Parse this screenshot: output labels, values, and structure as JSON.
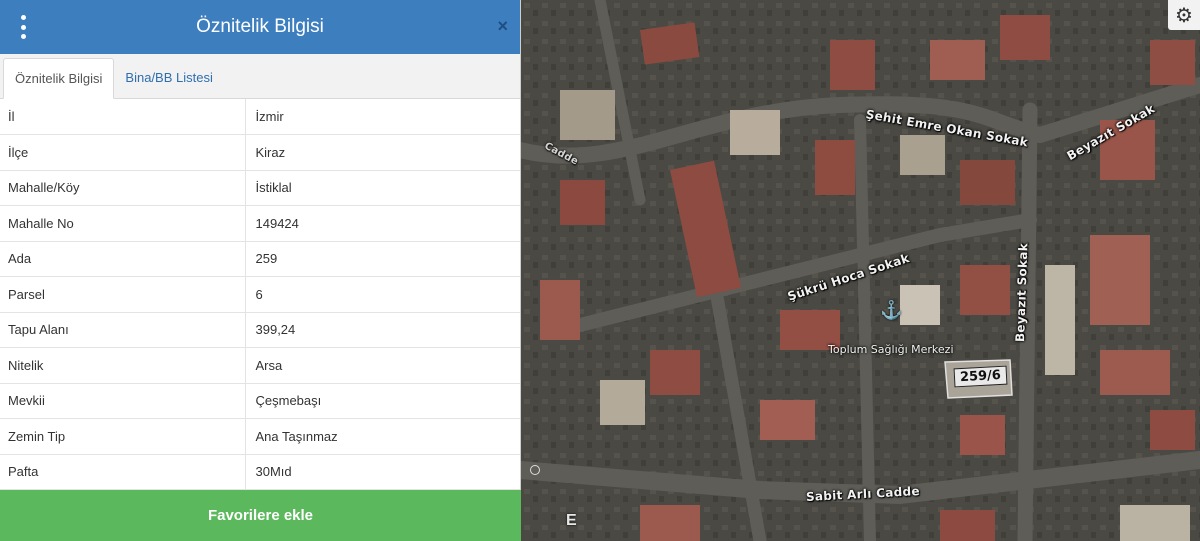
{
  "panel": {
    "title": "Öznitelik Bilgisi",
    "close_symbol": "×",
    "tabs": [
      {
        "label": "Öznitelik Bilgisi",
        "active": true
      },
      {
        "label": "Bina/BB Listesi",
        "active": false
      }
    ],
    "rows": [
      {
        "key": "İl",
        "value": "İzmir"
      },
      {
        "key": "İlçe",
        "value": "Kiraz"
      },
      {
        "key": "Mahalle/Köy",
        "value": "İstiklal"
      },
      {
        "key": "Mahalle No",
        "value": "149424"
      },
      {
        "key": "Ada",
        "value": "259"
      },
      {
        "key": "Parsel",
        "value": "6"
      },
      {
        "key": "Tapu Alanı",
        "value": "399,24"
      },
      {
        "key": "Nitelik",
        "value": "Arsa"
      },
      {
        "key": "Mevkii",
        "value": "Çeşmebaşı"
      },
      {
        "key": "Zemin Tip",
        "value": "Ana Taşınmaz"
      },
      {
        "key": "Pafta",
        "value": "30Mıd"
      }
    ],
    "favorite_button": "Favorilere ekle"
  },
  "map": {
    "streets": {
      "emre_okan": "Şehit Emre Okan Sokak",
      "beyazit_1": "Beyazıt Sokak",
      "beyazit_2": "Beyazıt Sokak",
      "sukru_hoca": "Şükrü Hoca Sokak",
      "sabit_arli": "Sabit Arlı Cadde",
      "cadde_fragment": "Cadde"
    },
    "poi": "Toplum Sağlığı Merkezi",
    "parcel_label": "259/6",
    "marker_letter": "E",
    "icons": {
      "settings": "gear-icon",
      "poi": "hospital-icon"
    }
  },
  "colors": {
    "header": "#3d7ebf",
    "favorite": "#5cb85c",
    "tab_link": "#2f6fb0"
  }
}
